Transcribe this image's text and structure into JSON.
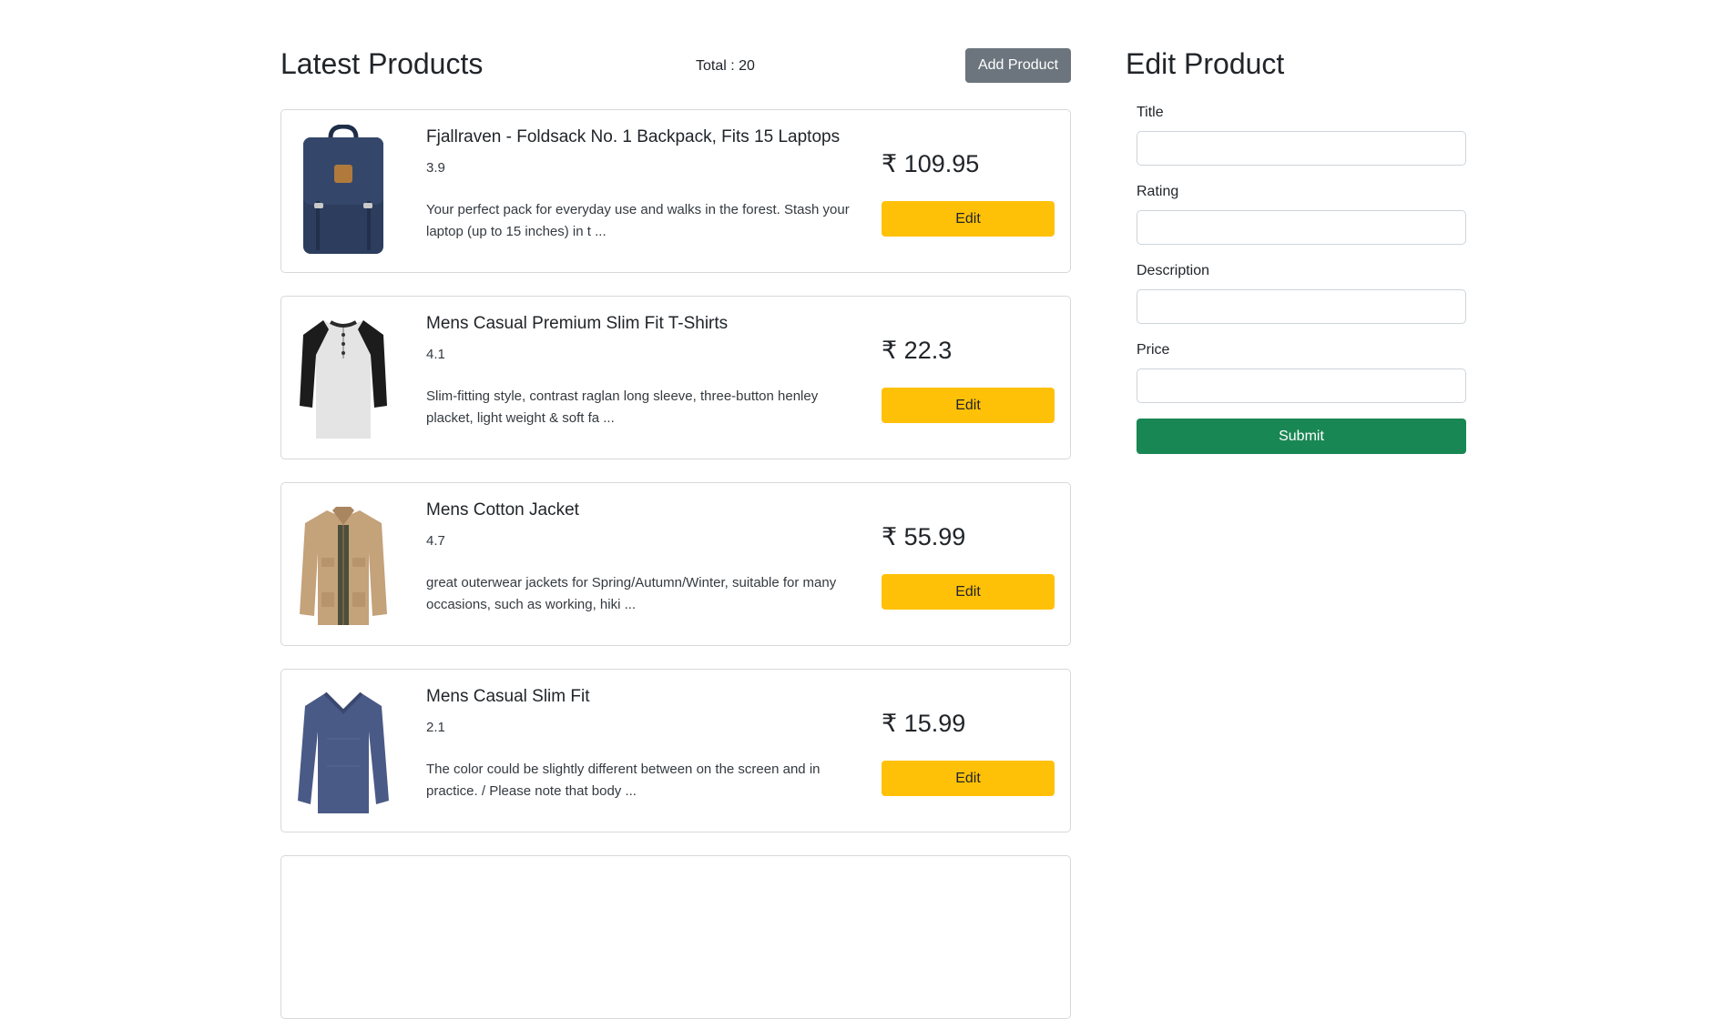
{
  "list": {
    "title": "Latest Products",
    "total_text": "Total : 20",
    "add_button": "Add Product",
    "edit_label": "Edit",
    "products": [
      {
        "title": "Fjallraven - Foldsack No. 1 Backpack, Fits 15 Laptops",
        "rating": "3.9",
        "description": "Your perfect pack for everyday use and walks in the forest. Stash your laptop (up to 15 inches) in t ...",
        "price": "₹ 109.95",
        "image": "backpack"
      },
      {
        "title": "Mens Casual Premium Slim Fit T-Shirts",
        "rating": "4.1",
        "description": "Slim-fitting style, contrast raglan long sleeve, three-button henley placket, light weight & soft fa ...",
        "price": "₹ 22.3",
        "image": "raglan-tshirt"
      },
      {
        "title": "Mens Cotton Jacket",
        "rating": "4.7",
        "description": "great outerwear jackets for Spring/Autumn/Winter, suitable for many occasions, such as working, hiki ...",
        "price": "₹ 55.99",
        "image": "cotton-jacket"
      },
      {
        "title": "Mens Casual Slim Fit",
        "rating": "2.1",
        "description": "The color could be slightly different between on the screen and in practice. / Please note that body ...",
        "price": "₹ 15.99",
        "image": "long-sleeve-shirt"
      }
    ]
  },
  "form": {
    "title": "Edit Product",
    "fields": [
      {
        "label": "Title",
        "value": ""
      },
      {
        "label": "Rating",
        "value": ""
      },
      {
        "label": "Description",
        "value": ""
      },
      {
        "label": "Price",
        "value": ""
      }
    ],
    "submit_label": "Submit"
  },
  "colors": {
    "add_button": "#6c757d",
    "edit_button": "#ffc107",
    "submit_button": "#198754"
  }
}
